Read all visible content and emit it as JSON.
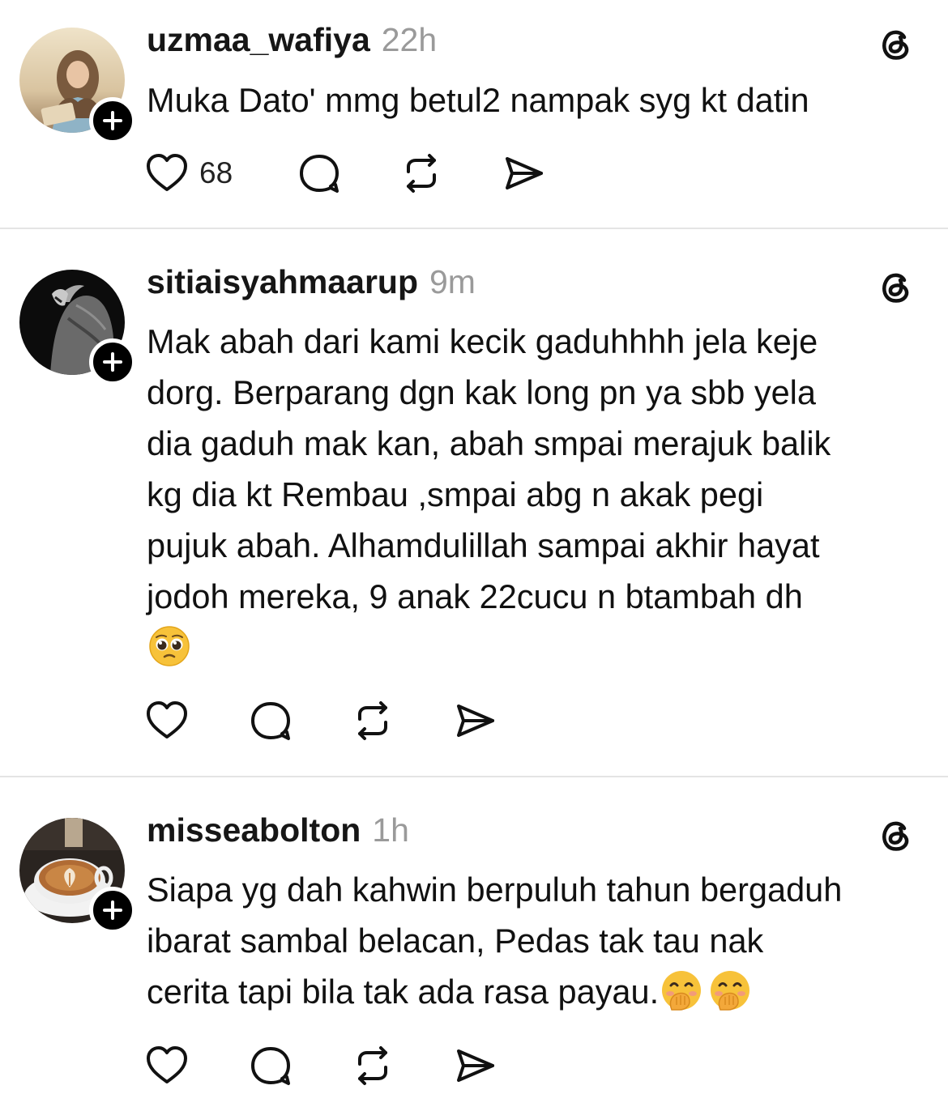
{
  "posts": [
    {
      "username": "uzmaa_wafiya",
      "time": "22h",
      "text_lines": [
        "Muka Dato' mmg betul2 nampak syg kt datin"
      ],
      "emoji": [],
      "like_count": "68",
      "avatar": "woman-in-hijab-reading-book",
      "icons": [
        "heart-icon",
        "comment-icon",
        "repost-icon",
        "share-icon",
        "threads-logo-icon",
        "follow-plus-icon"
      ]
    },
    {
      "username": "sitiaisyahmaarup",
      "time": "9m",
      "text_lines": [
        "Mak abah dari kami kecik gaduhhhh jela keje",
        "dorg. Berparang dgn kak long pn ya sbb yela",
        "dia gaduh mak kan, abah smpai merajuk balik",
        "kg dia kt Rembau ,smpai abg n akak pegi",
        "pujuk abah. Alhamdulillah sampai akhir hayat",
        "jodoh mereka, 9 anak 22cucu n btambah dh"
      ],
      "emoji": [
        "pleading-face-emoji"
      ],
      "like_count": "",
      "avatar": "roaring-lion-black-and-white"
    },
    {
      "username": "misseabolton",
      "time": "1h",
      "text_lines": [
        "Siapa yg dah kahwin berpuluh tahun bergaduh",
        "ibarat sambal belacan, Pedas tak tau nak",
        "cerita tapi bila tak ada rasa payau."
      ],
      "emoji": [
        "face-with-hand-over-mouth-emoji",
        "face-with-hand-over-mouth-emoji"
      ],
      "like_count": "",
      "avatar": "latte-art-coffee-cup"
    }
  ],
  "colors": {
    "background": "#ffffff",
    "text": "#101010",
    "muted": "#9a9a9a",
    "divider": "#e4e4e4",
    "badge": "#000000"
  }
}
